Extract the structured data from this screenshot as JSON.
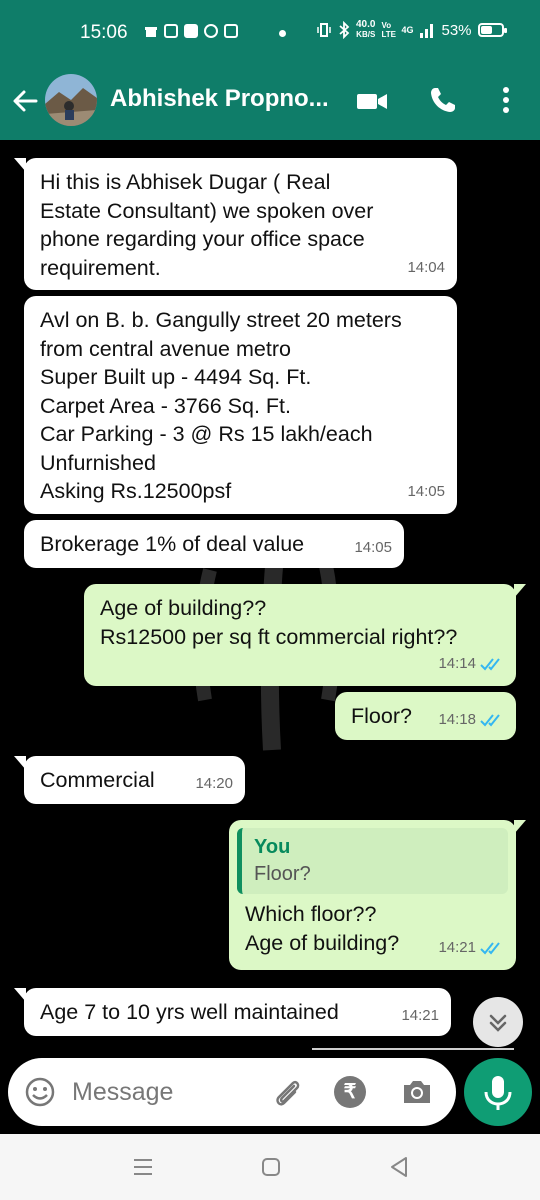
{
  "status_bar": {
    "time": "15:06",
    "network_speed_value": "40.0",
    "network_speed_unit": "KB/S",
    "volte": "Vo LTE",
    "signal": "4G",
    "battery_percent": "53%",
    "battery_level": 0.53
  },
  "header": {
    "contact_name": "Abhishek Propno...",
    "icons": [
      "back-arrow-icon",
      "avatar",
      "video-call-icon",
      "phone-icon",
      "more-vert-icon"
    ]
  },
  "messages": [
    {
      "dir": "in",
      "text": "Hi this is Abhisek Dugar ( Real\nEstate Consultant) we spoken over\nphone regarding your office space\nrequirement.",
      "time": "14:04"
    },
    {
      "dir": "in",
      "text": "Avl on B. b. Gangully street 20 meters\nfrom central avenue metro\nSuper Built up - 4494 Sq. Ft.\nCarpet Area - 3766 Sq. Ft.\nCar Parking - 3 @ Rs 15 lakh/each\nUnfurnished\nAsking Rs.12500psf",
      "time": "14:05"
    },
    {
      "dir": "in",
      "text": "Brokerage 1% of deal value",
      "time": "14:05"
    },
    {
      "dir": "out",
      "text": "Age of building??\nRs12500 per sq ft commercial right??",
      "time": "14:14",
      "status": "read"
    },
    {
      "dir": "out",
      "text": "Floor?",
      "time": "14:18",
      "status": "read"
    },
    {
      "dir": "in",
      "text": "Commercial",
      "time": "14:20"
    },
    {
      "dir": "out",
      "quote_author": "You",
      "quote_text": "Floor?",
      "text": "Which floor??\nAge of building?",
      "time": "14:21",
      "status": "read"
    },
    {
      "dir": "in",
      "text": "Age 7 to 10 yrs well maintained",
      "time": "14:21"
    }
  ],
  "composer": {
    "placeholder": "Message",
    "icons": [
      "emoji-icon",
      "attach-icon",
      "rupee-icon",
      "camera-icon",
      "mic-icon"
    ]
  },
  "colors": {
    "header_bg": "#0f7d69",
    "incoming_bubble": "#ffffff",
    "outgoing_bubble": "#dcf8c6",
    "read_ticks": "#34b7f1",
    "mic_button": "#0f9d74",
    "chat_bg": "#000000"
  }
}
